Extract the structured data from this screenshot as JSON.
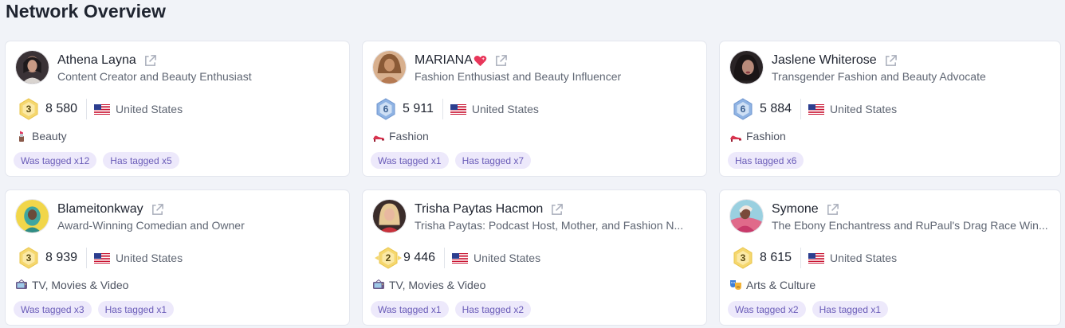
{
  "page_title": "Network Overview",
  "colors": {
    "background": "#f1f3f8",
    "card": "#ffffff",
    "tag_bg": "#ede9fb",
    "tag_text": "#6a5cb8",
    "gold_badge": "#f5d76e",
    "blue_badge": "#8fb3e3"
  },
  "cards": [
    {
      "name": "Athena Layna",
      "bio": "Content Creator and Beauty Enthusiast",
      "rank": "3",
      "rank_style": "gold",
      "score": "8 580",
      "country": "United States",
      "flag_icon": "us-flag-icon",
      "category_icon": "lipstick-icon",
      "category": "Beauty",
      "was_tagged": "Was tagged x12",
      "has_tagged": "Has tagged x5"
    },
    {
      "name": "MARIANA",
      "name_suffix_icon": "sparkling-heart-icon",
      "bio": "Fashion Enthusiast and Beauty Influencer",
      "rank": "6",
      "rank_style": "blue",
      "score": "5 911",
      "country": "United States",
      "flag_icon": "us-flag-icon",
      "category_icon": "high-heel-icon",
      "category": "Fashion",
      "was_tagged": "Was tagged x1",
      "has_tagged": "Has tagged x7"
    },
    {
      "name": "Jaslene Whiterose",
      "bio": "Transgender Fashion and Beauty Advocate",
      "rank": "6",
      "rank_style": "blue",
      "score": "5 884",
      "country": "United States",
      "flag_icon": "us-flag-icon",
      "category_icon": "high-heel-icon",
      "category": "Fashion",
      "was_tagged": "",
      "has_tagged": "Has tagged x6"
    },
    {
      "name": "Blameitonkway",
      "bio": "Award-Winning Comedian and Owner",
      "rank": "3",
      "rank_style": "gold",
      "score": "8 939",
      "country": "United States",
      "flag_icon": "us-flag-icon",
      "category_icon": "tv-icon",
      "category": "TV, Movies & Video",
      "was_tagged": "Was tagged x3",
      "has_tagged": "Has tagged x1"
    },
    {
      "name": "Trisha Paytas Hacmon",
      "bio": "Trisha Paytas: Podcast Host, Mother, and Fashion N...",
      "rank": "2",
      "rank_style": "gold",
      "score": "9 446",
      "country": "United States",
      "flag_icon": "us-flag-icon",
      "category_icon": "tv-icon",
      "category": "TV, Movies & Video",
      "was_tagged": "Was tagged x1",
      "has_tagged": "Has tagged x2"
    },
    {
      "name": "Symone",
      "bio": "The Ebony Enchantress and RuPaul's Drag Race Win...",
      "rank": "3",
      "rank_style": "gold",
      "score": "8 615",
      "country": "United States",
      "flag_icon": "us-flag-icon",
      "category_icon": "theater-masks-icon",
      "category": "Arts & Culture",
      "was_tagged": "Was tagged x2",
      "has_tagged": "Has tagged x1"
    }
  ]
}
